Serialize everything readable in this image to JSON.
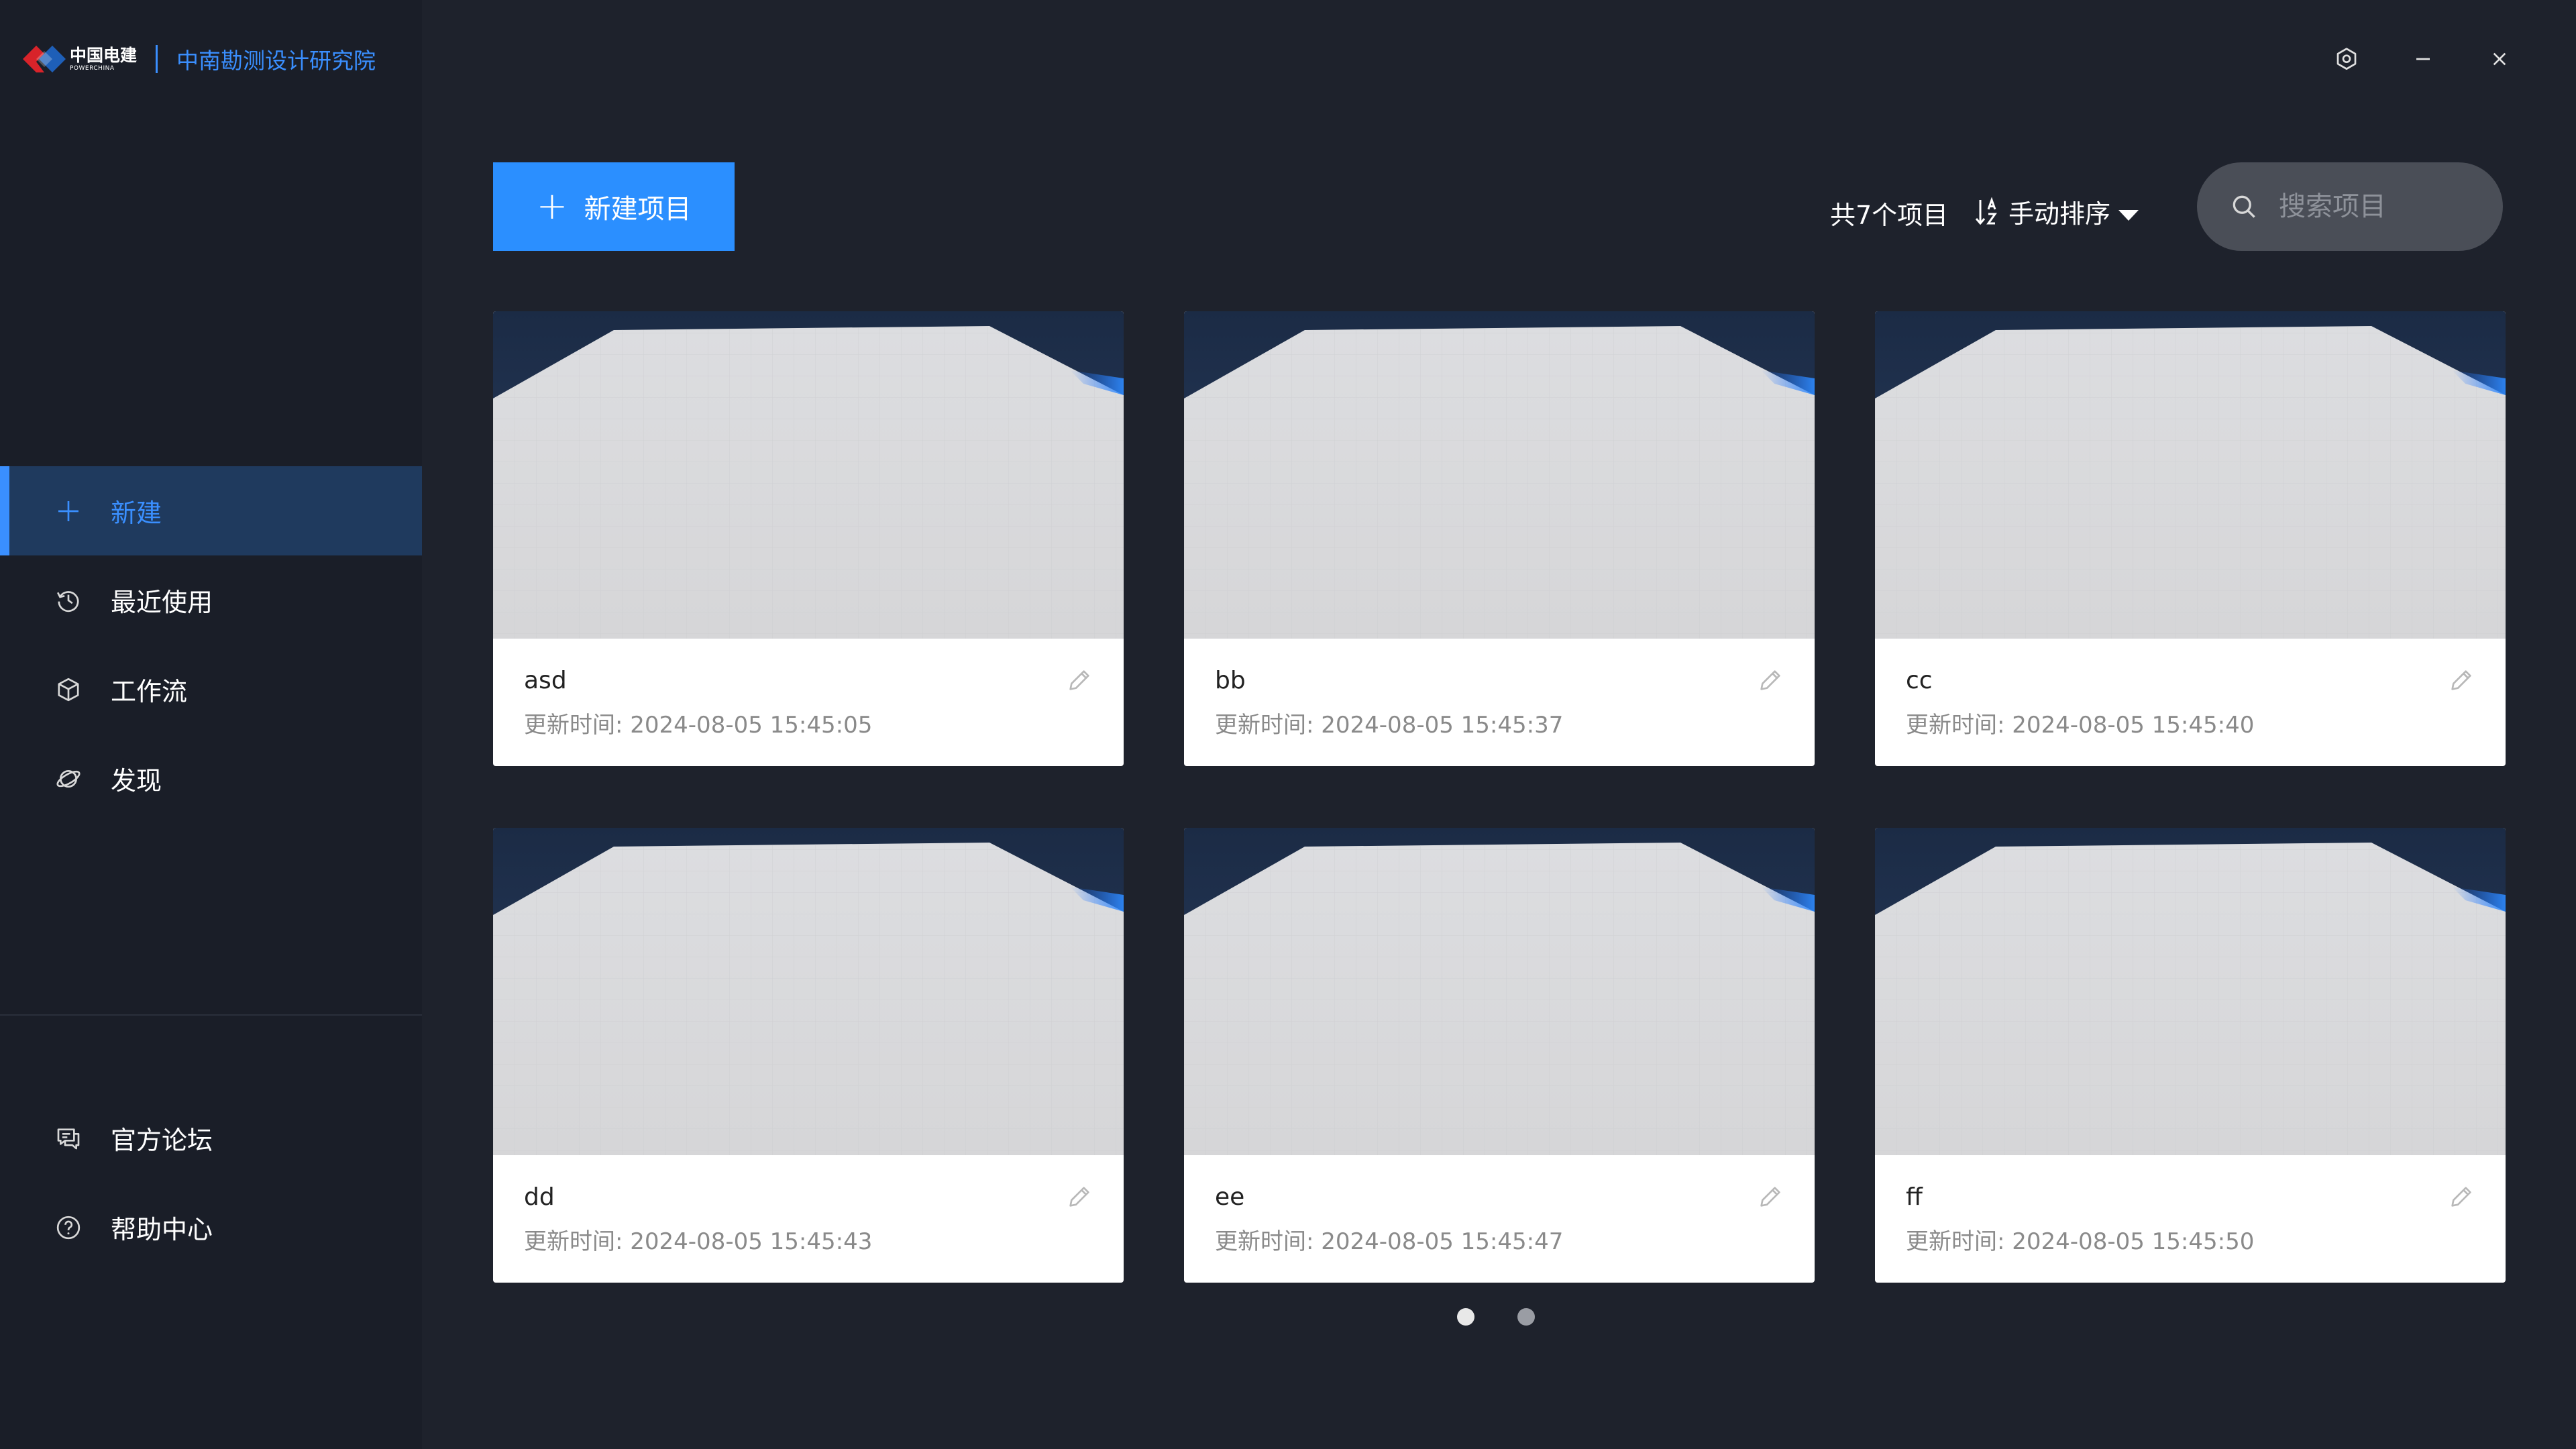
{
  "sidebar": {
    "logo_cn": "中国电建",
    "logo_en": "POWERCHINA",
    "org_name": "中南勘测设计研究院",
    "nav": [
      {
        "label": "新建",
        "icon": "plus-icon",
        "active": true
      },
      {
        "label": "最近使用",
        "icon": "history-icon",
        "active": false
      },
      {
        "label": "工作流",
        "icon": "workflow-cube-icon",
        "active": false
      },
      {
        "label": "发现",
        "icon": "planet-icon",
        "active": false
      }
    ],
    "bottom": [
      {
        "label": "官方论坛",
        "icon": "forum-icon"
      },
      {
        "label": "帮助中心",
        "icon": "help-icon"
      }
    ]
  },
  "toolbar": {
    "new_project_label": "新建项目",
    "count_label": "共7个项目",
    "sort_label": "手动排序",
    "search_placeholder": "搜索项目"
  },
  "projects": [
    {
      "name": "asd",
      "time": "更新时间:  2024-08-05 15:45:05"
    },
    {
      "name": "bb",
      "time": "更新时间:  2024-08-05 15:45:37"
    },
    {
      "name": "cc",
      "time": "更新时间:  2024-08-05 15:45:40"
    },
    {
      "name": "dd",
      "time": "更新时间:  2024-08-05 15:45:43"
    },
    {
      "name": "ee",
      "time": "更新时间:  2024-08-05 15:45:47"
    },
    {
      "name": "ff",
      "time": "更新时间:  2024-08-05 15:45:50"
    }
  ],
  "pagination": {
    "current": 1,
    "total": 2
  },
  "colors": {
    "accent": "#2b8fff",
    "sidebar_bg": "#1a1e28",
    "main_bg": "#1e222c",
    "active_nav_bg": "#1f3a5e"
  }
}
